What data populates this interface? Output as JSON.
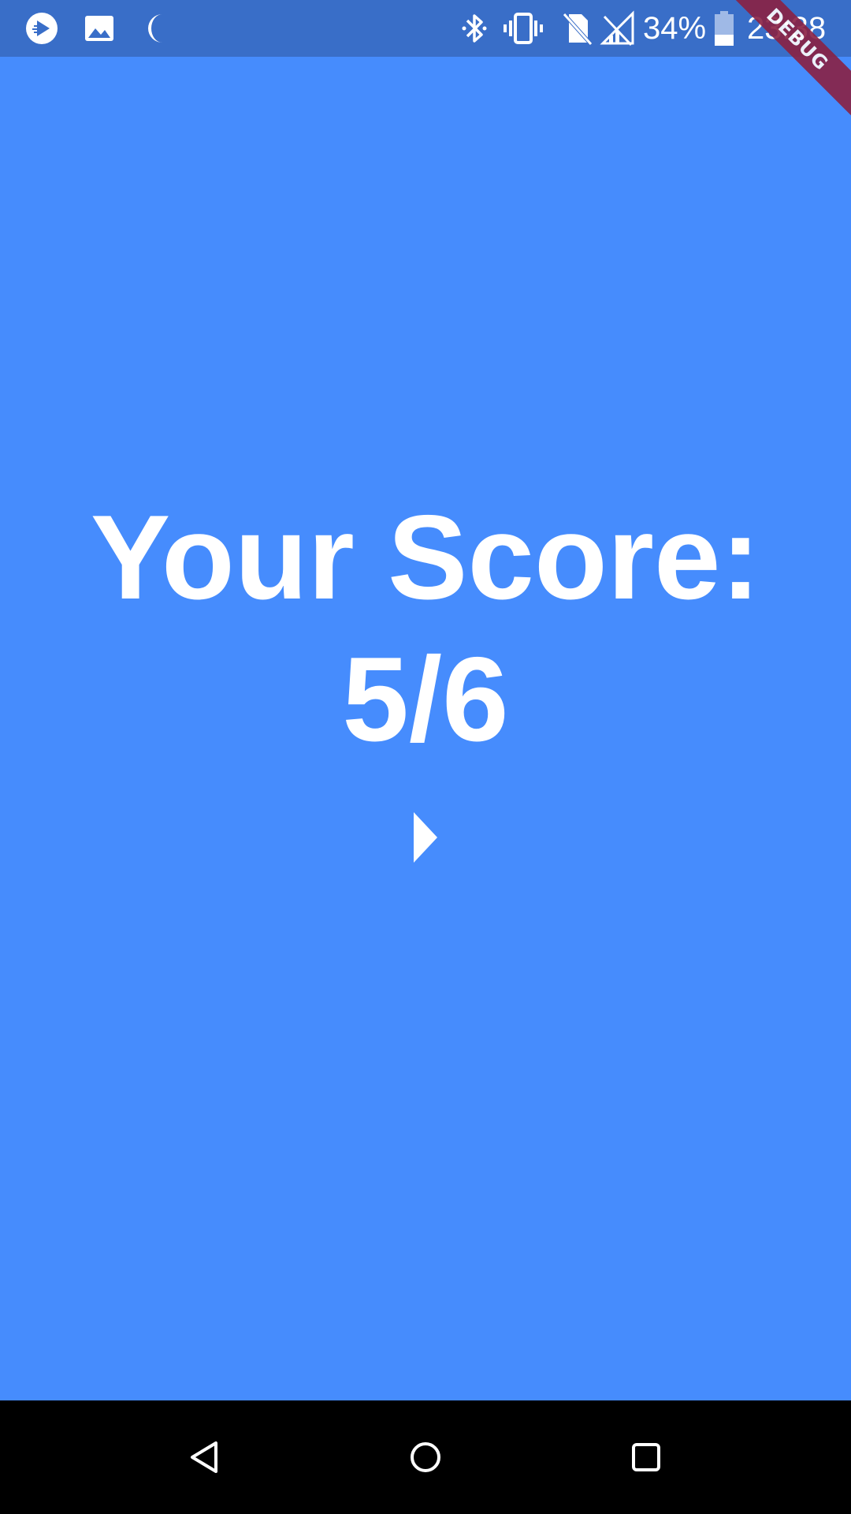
{
  "status_bar": {
    "left_icons": [
      "play-store-icon",
      "image-icon",
      "moon-icon"
    ],
    "right_icons": [
      "bluetooth-icon",
      "vibrate-icon",
      "no-sim-icon",
      "no-signal-icon",
      "battery-icon"
    ],
    "battery_percent": "34%",
    "battery_level": 0.34,
    "time": "23:38",
    "background_color": "#396ec8"
  },
  "debug_banner": {
    "label": "DEBUG",
    "color": "#8a2143"
  },
  "main": {
    "background_color": "#468cfd",
    "score_label": "Your Score:",
    "score_value": "5/6",
    "next_icon": "play-arrow-icon"
  },
  "nav_bar": {
    "buttons": [
      "back-icon",
      "home-icon",
      "recents-icon"
    ]
  }
}
